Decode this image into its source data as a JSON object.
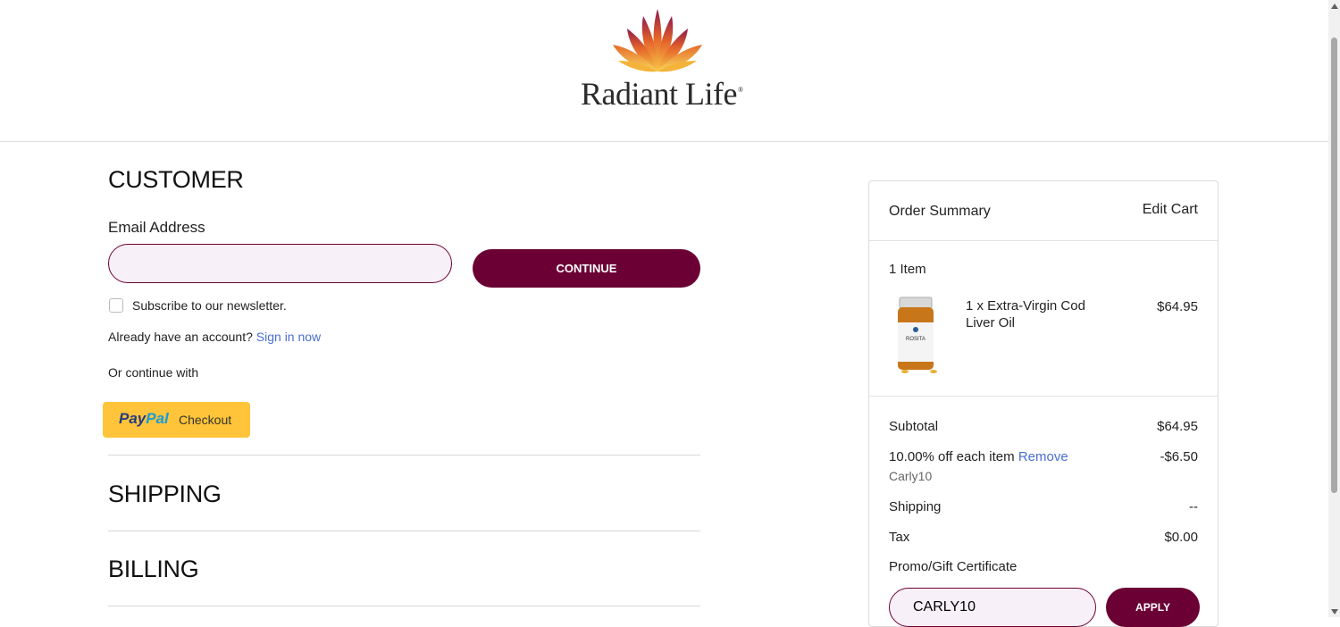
{
  "brand": {
    "name": "Radiant Life",
    "registered": "®"
  },
  "customer": {
    "title": "CUSTOMER",
    "email_label": "Email Address",
    "email_value": "",
    "continue_label": "CONTINUE",
    "newsletter_label": "Subscribe to our newsletter.",
    "account_prompt": "Already have an account?",
    "sign_in_label": "Sign in now",
    "or_continue": "Or continue with",
    "paypal_brand_1": "Pay",
    "paypal_brand_2": "Pal",
    "paypal_checkout": "Checkout"
  },
  "sections": {
    "shipping": "SHIPPING",
    "billing": "BILLING"
  },
  "order_summary": {
    "title": "Order Summary",
    "edit_cart": "Edit Cart",
    "item_count": "1 Item",
    "items": [
      {
        "name": "1 x Extra-Virgin Cod Liver Oil",
        "price": "$64.95",
        "label_text": "ROSITA"
      }
    ],
    "subtotal_label": "Subtotal",
    "subtotal_value": "$64.95",
    "discount_label": "10.00% off each item",
    "discount_remove": "Remove",
    "discount_value": "-$6.50",
    "discount_code": "Carly10",
    "shipping_label": "Shipping",
    "shipping_value": "--",
    "tax_label": "Tax",
    "tax_value": "$0.00",
    "promo_label": "Promo/Gift Certificate",
    "promo_value": "CARLY10",
    "apply_label": "APPLY"
  },
  "colors": {
    "accent": "#6b0034",
    "link": "#4a6fd1",
    "paypal": "#ffc439"
  }
}
